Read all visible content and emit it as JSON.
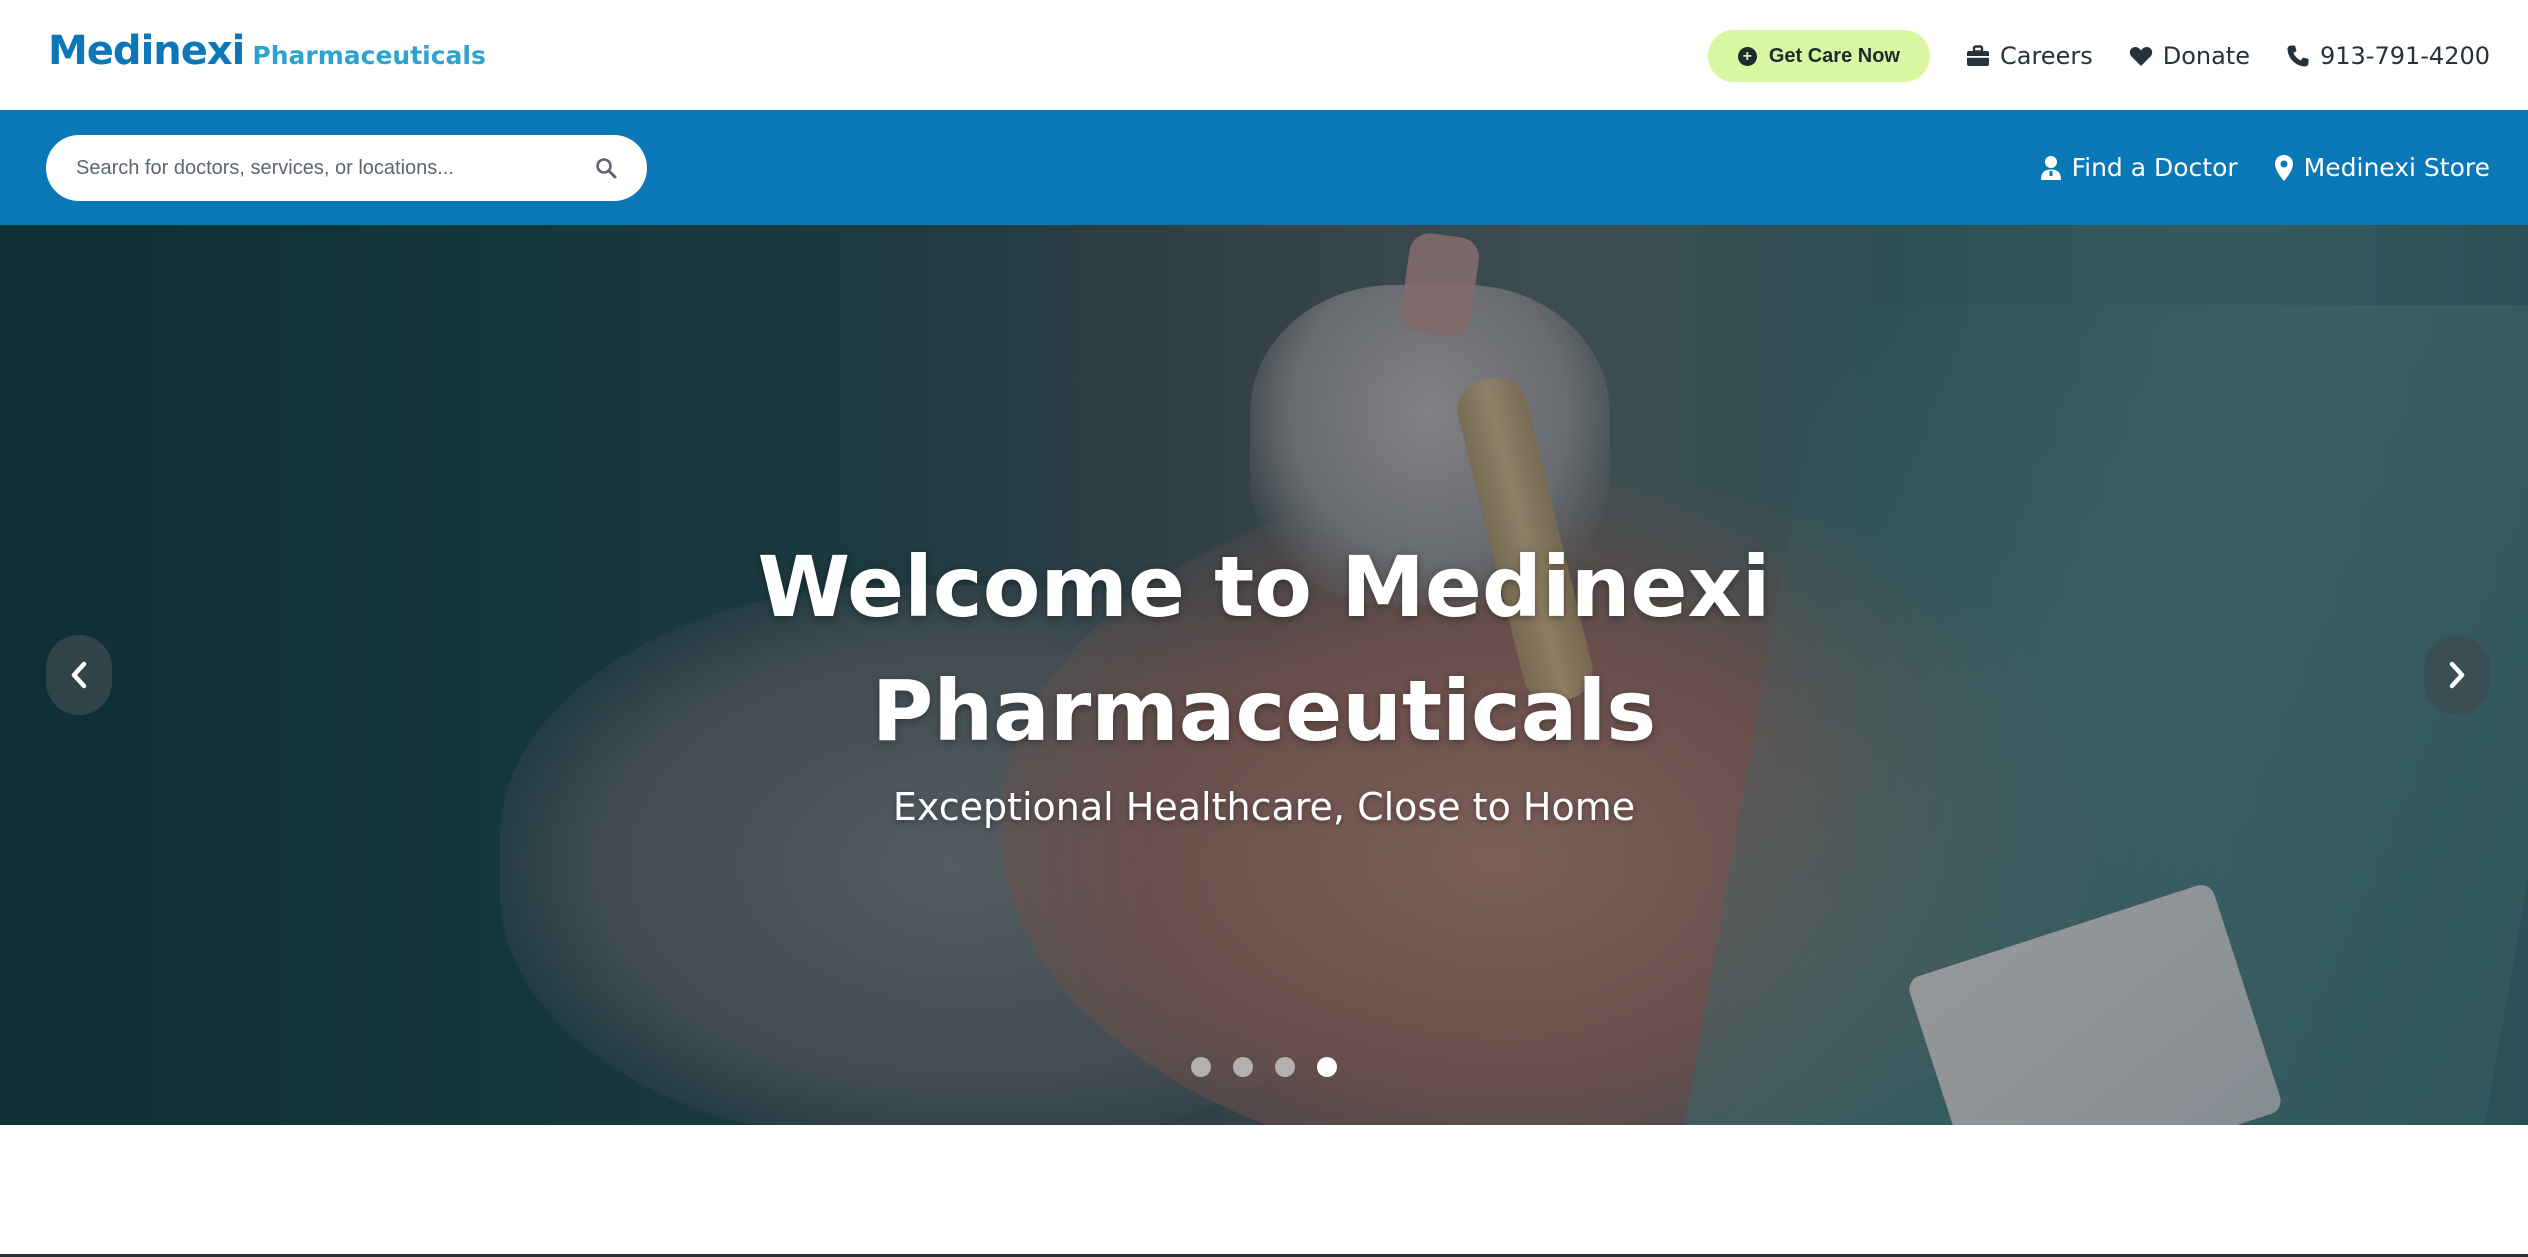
{
  "header": {
    "logo_main": "Medinexi",
    "logo_sub": "Pharmaceuticals",
    "care_button": "Get Care Now",
    "links": [
      {
        "label": "Careers",
        "icon": "briefcase-icon"
      },
      {
        "label": "Donate",
        "icon": "heart-icon"
      },
      {
        "label": "913-791-4200",
        "icon": "phone-icon"
      }
    ]
  },
  "subnav": {
    "search_placeholder": "Search for doctors, services, or locations...",
    "links": [
      {
        "label": "Find a Doctor",
        "icon": "person-icon"
      },
      {
        "label": "Medinexi Store",
        "icon": "map-pin-icon"
      }
    ]
  },
  "hero": {
    "title_line1": "Welcome to Medinexi",
    "title_line2": "Pharmaceuticals",
    "subtitle": "Exceptional Healthcare, Close to Home",
    "slide_count": 4,
    "active_slide": 4
  },
  "colors": {
    "brand_blue": "#0a77b7",
    "logo_sub": "#2fa3cf",
    "care_button_bg": "#d9f7a0"
  }
}
